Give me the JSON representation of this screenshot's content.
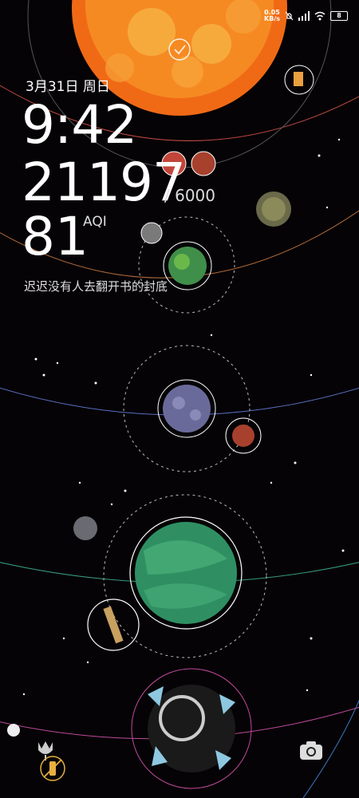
{
  "status_bar": {
    "net_speed": "0.05",
    "net_unit": "KB/s",
    "battery": "8",
    "icons": [
      "mute-icon",
      "signal-icon",
      "wifi-icon",
      "battery-icon"
    ]
  },
  "lockscreen": {
    "date": "3月31日 周日",
    "time": "9:42",
    "steps": "21197",
    "steps_goal": "/ 6000",
    "aqi_value": "81",
    "aqi_label": "AQI",
    "quote": "迟迟没有人去翻开书的封底"
  },
  "bottom_bar": {
    "left_icons": [
      "dot-icon",
      "tulip-icon",
      "no-flashlight-icon"
    ],
    "right_icon": "camera-icon"
  },
  "colors": {
    "background": "#050306",
    "sun": "#f0701a",
    "green_planet": "#3aa36f",
    "accent_red": "#e14b3d"
  }
}
